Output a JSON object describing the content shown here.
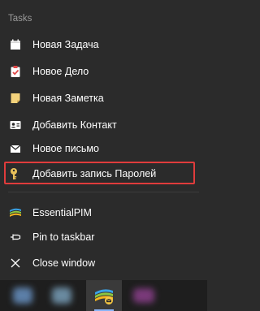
{
  "jumplist": {
    "section_title": "Tasks",
    "tasks": [
      {
        "label": "Новая Задача",
        "icon": "calendar-icon"
      },
      {
        "label": "Новое Дело",
        "icon": "clipboard-check-icon"
      },
      {
        "label": "Новая Заметка",
        "icon": "note-icon"
      },
      {
        "label": "Добавить Контакт",
        "icon": "contact-card-icon"
      },
      {
        "label": "Новое письмо",
        "icon": "mail-icon"
      },
      {
        "label": "Добавить запись Паролей",
        "icon": "key-icon"
      }
    ],
    "app": {
      "label": "EssentialPIM",
      "icon": "essentialpim-logo-icon"
    },
    "actions": [
      {
        "label": "Pin to taskbar",
        "icon": "pin-icon"
      },
      {
        "label": "Close window",
        "icon": "close-icon"
      }
    ]
  },
  "colors": {
    "background": "#2b2b2b",
    "taskbar": "#1e1e1e",
    "highlight_border": "#e03c3c",
    "section_title": "#9a9a9a"
  }
}
